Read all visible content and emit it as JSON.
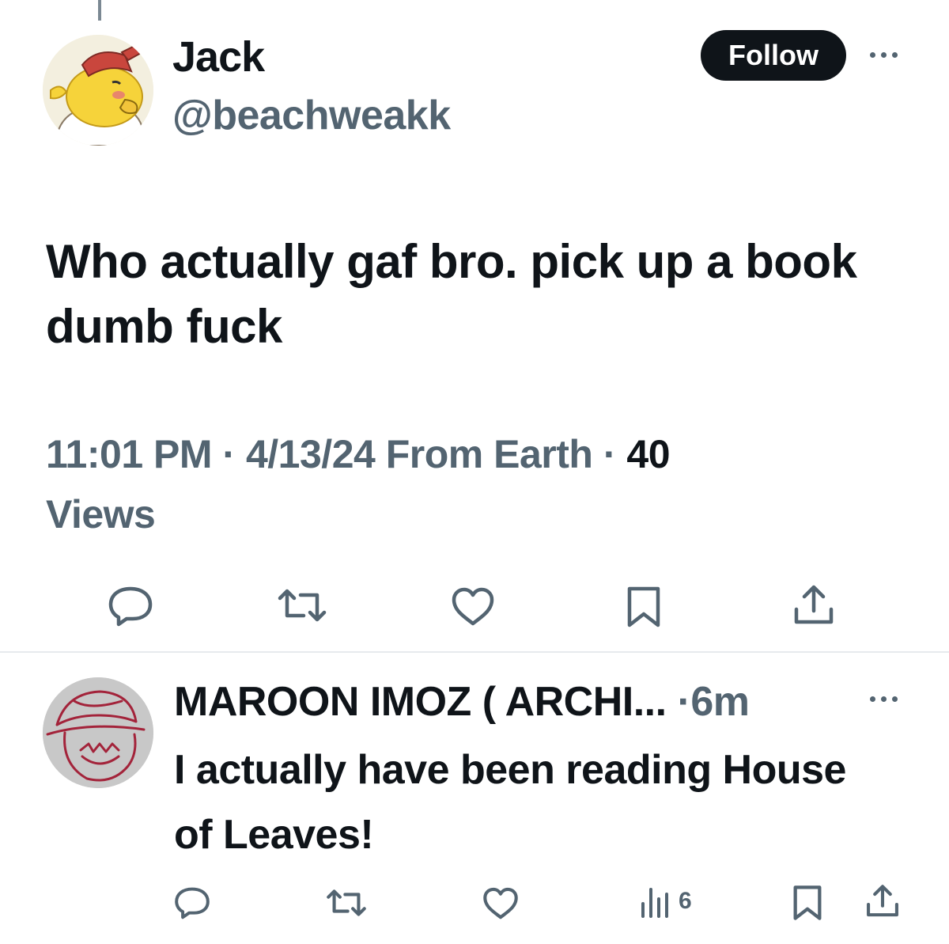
{
  "main_tweet": {
    "author_name": "Jack",
    "author_handle": "@beachweakk",
    "follow_label": "Follow",
    "text": "Who actually gaf bro. pick up a book dumb fuck",
    "time": "11:01 PM",
    "separator": "·",
    "date": "4/13/24",
    "source": "From Earth",
    "views_count": "40",
    "views_label": "Views",
    "actions": [
      "reply-icon",
      "retweet-icon",
      "like-icon",
      "bookmark-icon",
      "share-icon"
    ]
  },
  "reply": {
    "author_name": "MAROON IMOZ ( ARCHI...",
    "separator": "·",
    "age": "6m",
    "text": "I actually have been reading House of Leaves!",
    "views_count": "6",
    "actions": [
      "reply-icon",
      "retweet-icon",
      "like-icon",
      "views-icon",
      "bookmark-icon",
      "share-icon"
    ]
  },
  "colors": {
    "text_primary": "#0f1419",
    "text_secondary": "#536471",
    "divider": "#e7eaed",
    "follow_bg": "#0f1419"
  }
}
